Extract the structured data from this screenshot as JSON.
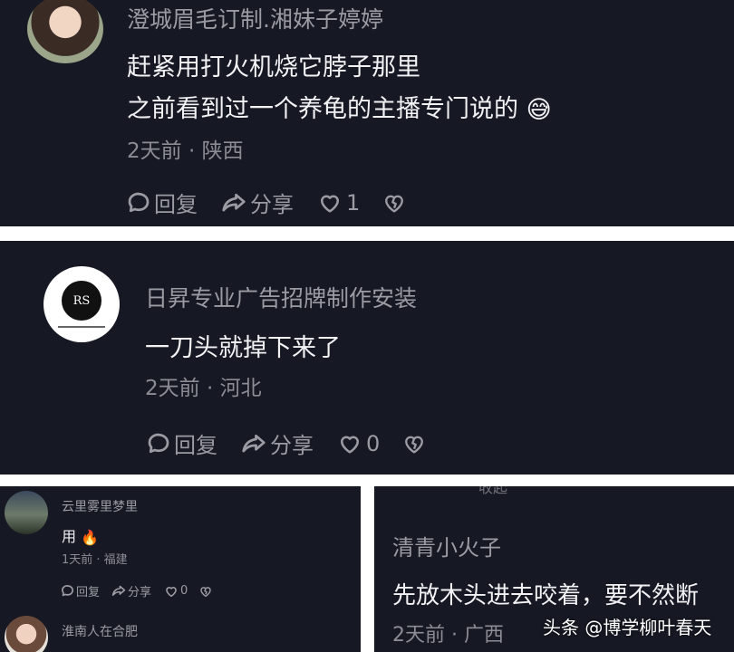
{
  "comment1": {
    "username": "澄城眉毛订制.湘妹子婷婷",
    "line1": "赶紧用打火机烧它脖子那里",
    "line2": "之前看到过一个养龟的主播专门说的",
    "emoji": "😅",
    "meta": "2天前 · 陕西",
    "reply": "回复",
    "share": "分享",
    "likes": "1"
  },
  "comment2": {
    "username": "日昇专业广告招牌制作安装",
    "avatar_text": "RS",
    "text": "一刀头就掉下来了",
    "meta": "2天前 · 河北",
    "reply": "回复",
    "share": "分享",
    "likes": "0"
  },
  "comment3": {
    "username": "云里雾里梦里",
    "text": "用",
    "emoji": "🔥",
    "meta": "1天前 · 福建",
    "reply": "回复",
    "share": "分享",
    "likes": "0"
  },
  "comment4": {
    "username": "淮南人在合肥"
  },
  "comment5": {
    "top_fragment": "收起 ^",
    "username": "清青小火子",
    "text": "先放木头进去咬着，要不然断",
    "meta": "2天前 · 广西"
  },
  "watermark": "头条 @博学柳叶春天"
}
